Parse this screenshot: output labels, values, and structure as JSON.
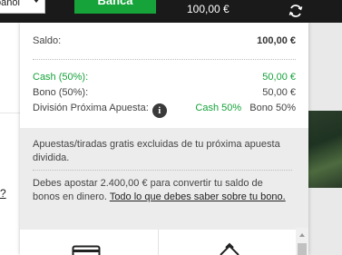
{
  "topbar": {
    "language": "pañol",
    "bank_label": "Banca",
    "balance": "100,00 €"
  },
  "background": {
    "question_mark": "?"
  },
  "panel": {
    "saldo_label": "Saldo:",
    "saldo_value": "100,00 €",
    "cash_label": "Cash (50%):",
    "cash_value": "50,00 €",
    "bono_label": "Bono (50%):",
    "bono_value": "50,00 €",
    "division_label": "División Próxima Apuesta:",
    "division_cash": "Cash 50%",
    "division_bono": "Bono 50%",
    "info_note": "Apuestas/tiradas gratis excluidas de tu próxima apuesta dividida.",
    "wager_text": "Debes apostar 2.400,00 € para convertir tu saldo de bonos en dinero.",
    "wager_link": "Todo lo que debes saber sobre tu bono."
  },
  "colors": {
    "accent_green": "#16a33a",
    "topbar_bg": "#1a1a1a"
  },
  "icons": {
    "refresh": "refresh-icon",
    "info": "info-icon",
    "card": "credit-card-icon",
    "gift": "gift-icon"
  }
}
